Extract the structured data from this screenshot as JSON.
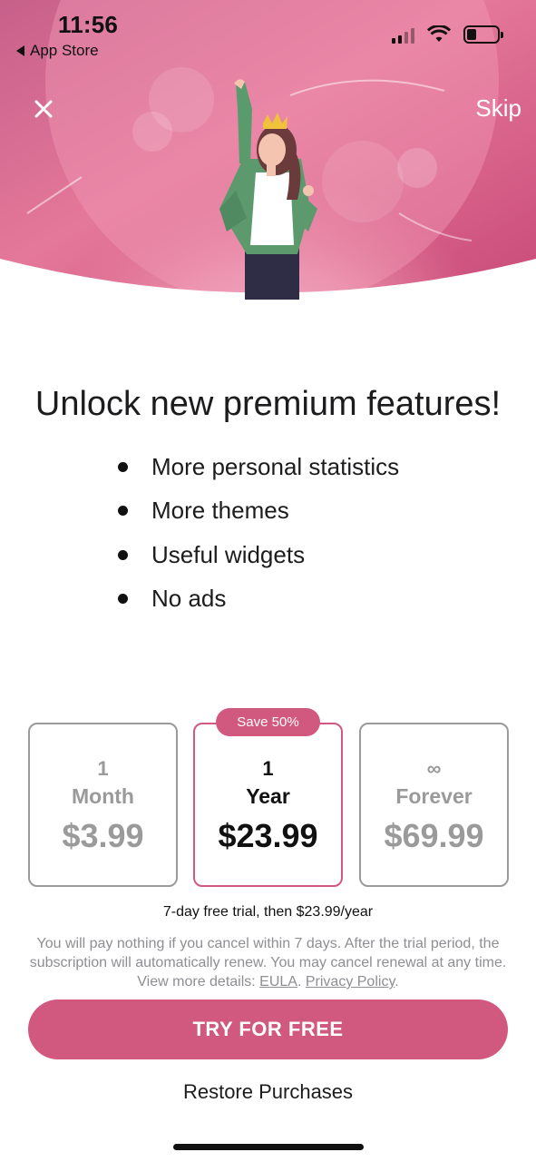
{
  "status_bar": {
    "time": "11:56",
    "back_label": "App Store"
  },
  "header": {
    "skip_label": "Skip",
    "accent_color": "#d1587f"
  },
  "headline": "Unlock new premium features!",
  "features": [
    "More personal statistics",
    "More themes",
    "Useful widgets",
    "No ads"
  ],
  "plans": [
    {
      "num": "1",
      "period": "Month",
      "price": "$3.99",
      "selected": false
    },
    {
      "num": "1",
      "period": "Year",
      "price": "$23.99",
      "selected": true,
      "badge": "Save 50%"
    },
    {
      "num": "∞",
      "period": "Forever",
      "price": "$69.99",
      "selected": false
    }
  ],
  "trial_text": "7-day free trial, then $23.99/year",
  "legal": {
    "text": "You will pay nothing if you cancel within 7 days. After the trial period, the subscription will automatically renew. You may cancel renewal at any time. View more details: ",
    "eula": "EULA",
    "sep": ". ",
    "privacy": "Privacy Policy",
    "end": "."
  },
  "cta_label": "TRY FOR FREE",
  "restore_label": "Restore Purchases"
}
